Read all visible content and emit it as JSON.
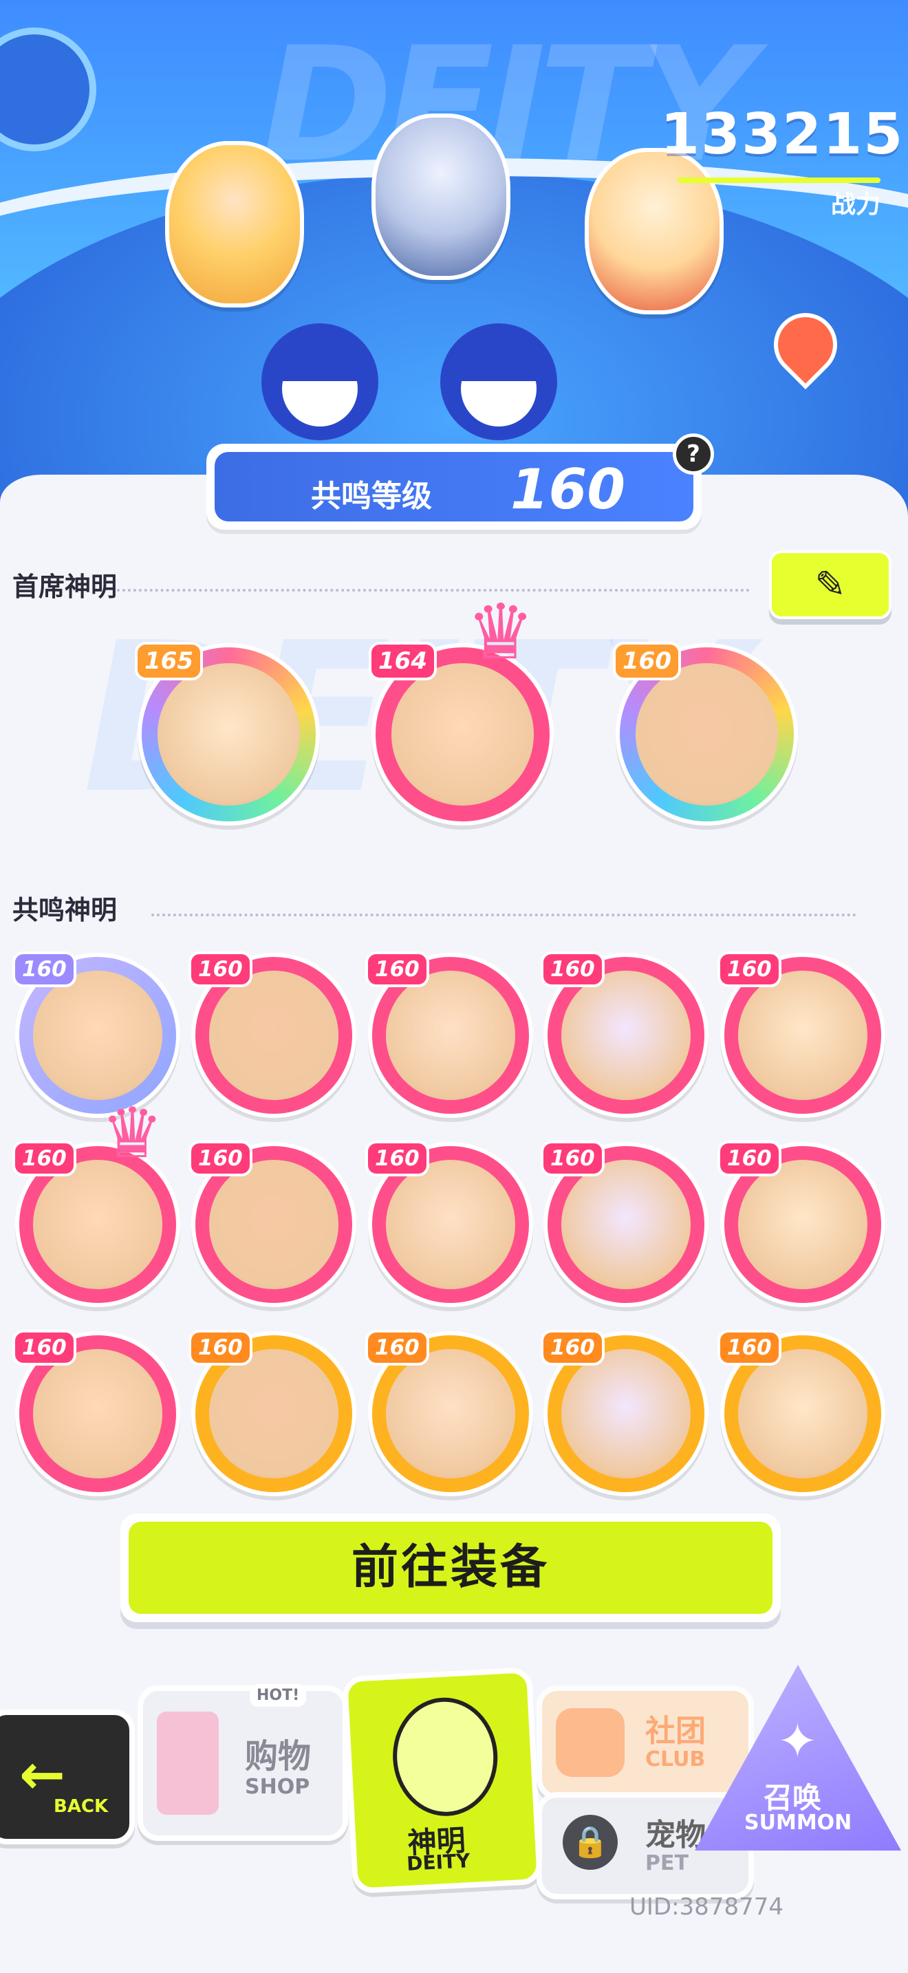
{
  "header": {
    "power_value": "133215",
    "power_label": "战力",
    "resonance_label": "共鸣等级",
    "resonance_level": "160",
    "help": "?",
    "watermark": "DEITY"
  },
  "chief": {
    "title": "首席神明",
    "edit_icon": "pencil-icon",
    "members": [
      {
        "level": "165",
        "ring": "rainbow",
        "crown": false
      },
      {
        "level": "164",
        "ring": "pink",
        "crown": true
      },
      {
        "level": "160",
        "ring": "rainbow",
        "crown": false
      }
    ]
  },
  "resonance": {
    "title": "共鸣神明",
    "members": [
      {
        "level": "160",
        "ring": "purple",
        "crown": false
      },
      {
        "level": "160",
        "ring": "pink",
        "crown": false
      },
      {
        "level": "160",
        "ring": "pink",
        "crown": false
      },
      {
        "level": "160",
        "ring": "pink",
        "crown": false
      },
      {
        "level": "160",
        "ring": "pink",
        "crown": false
      },
      {
        "level": "160",
        "ring": "pink",
        "crown": true
      },
      {
        "level": "160",
        "ring": "pink",
        "crown": false
      },
      {
        "level": "160",
        "ring": "pink",
        "crown": false
      },
      {
        "level": "160",
        "ring": "pink",
        "crown": false
      },
      {
        "level": "160",
        "ring": "pink",
        "crown": false
      },
      {
        "level": "160",
        "ring": "pink",
        "crown": false
      },
      {
        "level": "160",
        "ring": "gold",
        "crown": false
      },
      {
        "level": "160",
        "ring": "gold",
        "crown": false
      },
      {
        "level": "160",
        "ring": "gold",
        "crown": false
      },
      {
        "level": "160",
        "ring": "gold",
        "crown": false
      }
    ]
  },
  "equip": {
    "label": "前往装备"
  },
  "nav": {
    "back_en": "BACK",
    "shop_cn": "购物",
    "shop_en": "SHOP",
    "shop_tag": "HOT!",
    "deity_cn": "神明",
    "deity_en": "DEITY",
    "club_cn": "社团",
    "club_en": "CLUB",
    "pet_cn": "宠物",
    "pet_en": "PET",
    "summon_cn": "召唤",
    "summon_en": "SUMMON"
  },
  "uid": "UID:3878774",
  "colors": {
    "accent_lime": "#e6ff2f",
    "ring_pink": "#ff4f8a",
    "ring_gold": "#ffb21f",
    "ring_purple": "#a98bff",
    "banner_blue": "#3f8cff"
  }
}
